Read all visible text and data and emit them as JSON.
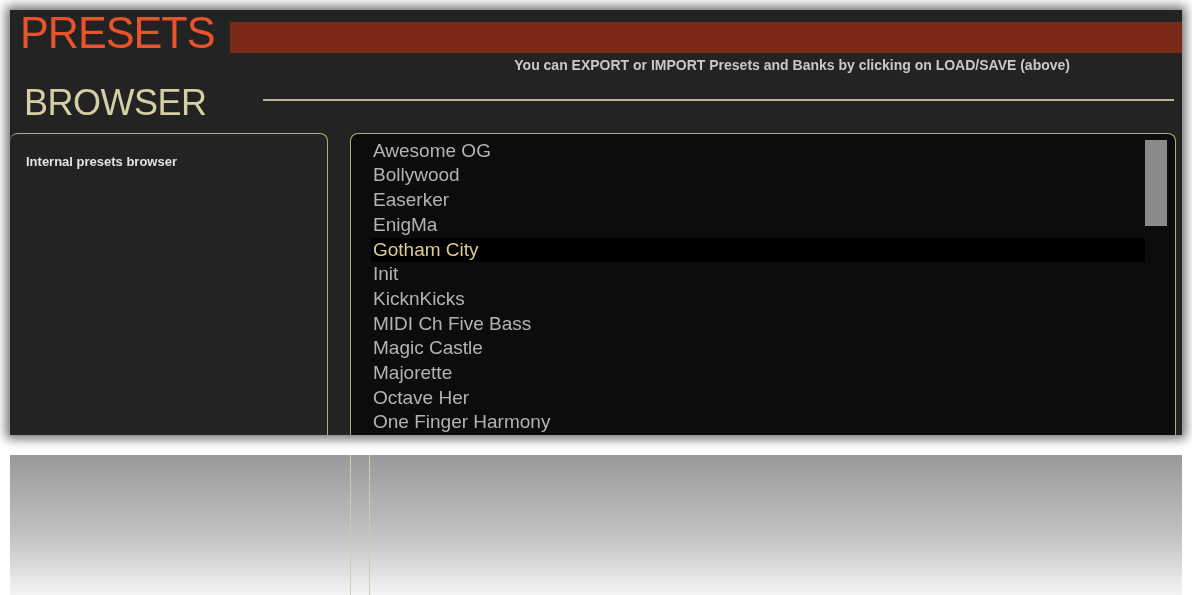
{
  "header": {
    "title": "PRESETS",
    "info": "You can EXPORT or IMPORT Presets and Banks by clicking on LOAD/SAVE (above)"
  },
  "browser": {
    "title": "BROWSER",
    "description": "Internal presets browser"
  },
  "presets": [
    {
      "name": "Awesome OG",
      "selected": false
    },
    {
      "name": "Bollywood",
      "selected": false
    },
    {
      "name": "Easerker",
      "selected": false
    },
    {
      "name": "EnigMa",
      "selected": false
    },
    {
      "name": "Gotham City",
      "selected": true
    },
    {
      "name": "Init",
      "selected": false
    },
    {
      "name": "KicknKicks",
      "selected": false
    },
    {
      "name": "MIDI Ch Five Bass",
      "selected": false
    },
    {
      "name": "Magic Castle",
      "selected": false
    },
    {
      "name": "Majorette",
      "selected": false
    },
    {
      "name": "Octave Her",
      "selected": false
    },
    {
      "name": "One Finger Harmony",
      "selected": false
    }
  ]
}
